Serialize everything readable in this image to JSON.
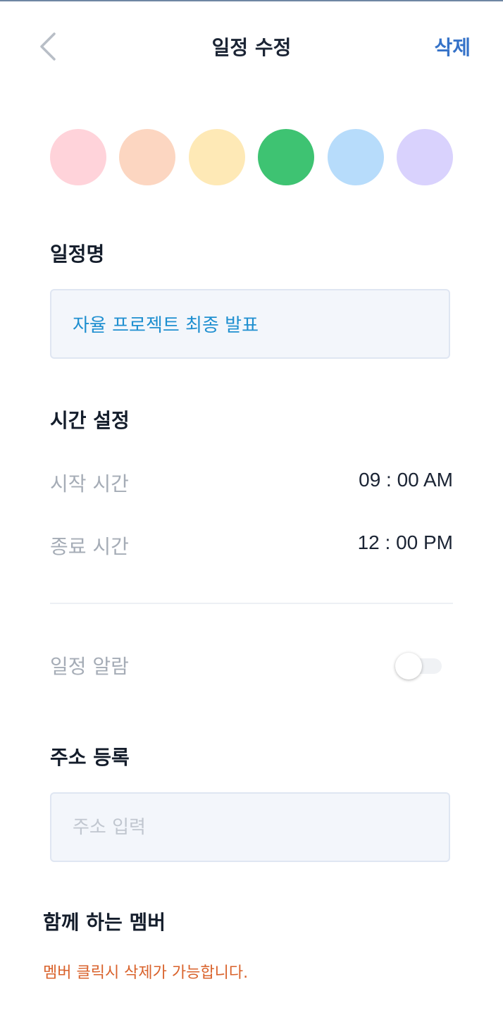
{
  "header": {
    "title": "일정 수정",
    "delete_label": "삭제",
    "back_icon": "chevron-left-icon"
  },
  "colors": {
    "selected": "green",
    "swatches": [
      {
        "name": "pink",
        "hex": "#ffd3da"
      },
      {
        "name": "peach",
        "hex": "#fcd6c1"
      },
      {
        "name": "yellow",
        "hex": "#fee9b6"
      },
      {
        "name": "green",
        "hex": "#3ec372"
      },
      {
        "name": "sky",
        "hex": "#b7dcfb"
      },
      {
        "name": "lavender",
        "hex": "#d9d2fd"
      }
    ]
  },
  "schedule_name": {
    "label": "일정명",
    "value": "자율 프로젝트 최종 발표"
  },
  "time": {
    "label": "시간 설정",
    "start_label": "시작 시간",
    "start_value": "09 : 00 AM",
    "end_label": "종료 시간",
    "end_value": "12 : 00 PM"
  },
  "alarm": {
    "label": "일정 알람",
    "enabled": false
  },
  "address": {
    "label": "주소 등록",
    "value": "",
    "placeholder": "주소 입력"
  },
  "members": {
    "label": "함께 하는 멤버",
    "note": "멤버 클릭시 삭제가 가능합니다."
  },
  "theme": {
    "accent": "#3572c8",
    "input_text": "#1f8fd0",
    "warning": "#d9622b"
  }
}
